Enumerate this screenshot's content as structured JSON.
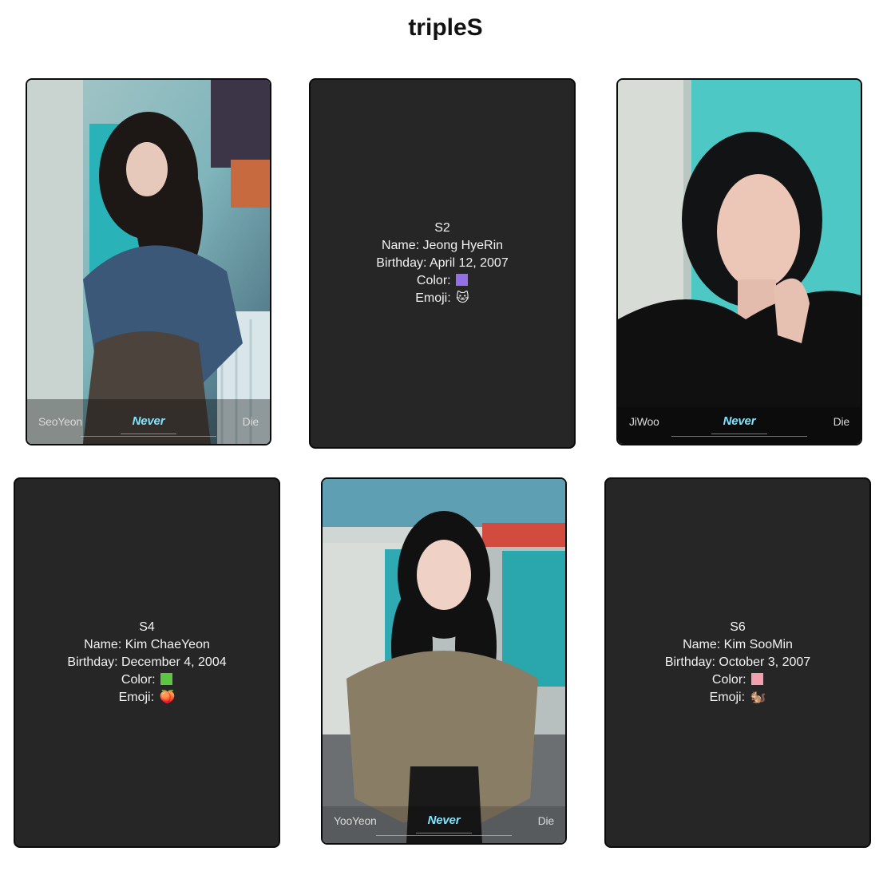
{
  "page": {
    "title": "tripleS"
  },
  "cards": [
    {
      "kind": "photo",
      "name": "SeoYeon",
      "title": "Never",
      "suffix": "Die"
    },
    {
      "kind": "info",
      "serial": "S2",
      "name_line": "Name: Jeong HyeRin",
      "birthday_line": "Birthday: April 12, 2007",
      "color_label": "Color:",
      "color_hex": "#9370e8",
      "emoji_label": "Emoji:",
      "emoji": "🐱"
    },
    {
      "kind": "photo",
      "name": "JiWoo",
      "title": "Never",
      "suffix": "Die"
    },
    {
      "kind": "info",
      "serial": "S4",
      "name_line": "Name: Kim ChaeYeon",
      "birthday_line": "Birthday: December 4, 2004",
      "color_label": "Color:",
      "color_hex": "#5dc541",
      "emoji_label": "Emoji:",
      "emoji": "🍑"
    },
    {
      "kind": "photo",
      "name": "YooYeon",
      "title": "Never",
      "suffix": "Die"
    },
    {
      "kind": "info",
      "serial": "S6",
      "name_line": "Name: Kim SooMin",
      "birthday_line": "Birthday: October 3, 2007",
      "color_label": "Color:",
      "color_hex": "#f0a0ae",
      "emoji_label": "Emoji:",
      "emoji": "🐿️"
    }
  ]
}
